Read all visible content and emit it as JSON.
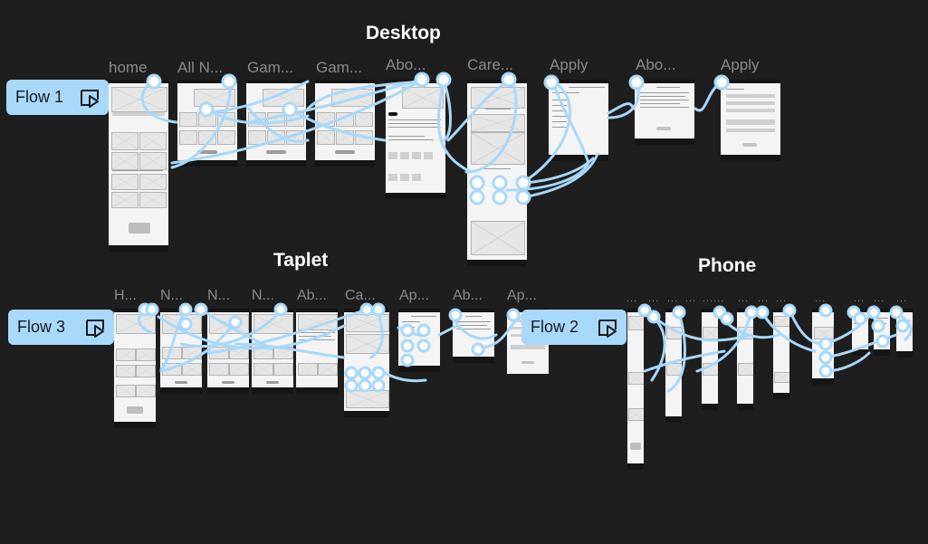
{
  "sections": {
    "desktop": "Desktop",
    "tablet": "Taplet",
    "phone": "Phone"
  },
  "flows": {
    "flow1": "Flow 1",
    "flow2": "Flow 2",
    "flow3": "Flow 3"
  },
  "desktop_frames": [
    "home",
    "All N...",
    "Gam...",
    "Gam...",
    "Abo...",
    "Care...",
    "Apply",
    "Abo...",
    "Apply"
  ],
  "tablet_frames": [
    "H...",
    "N...",
    "N...",
    "N...",
    "Ab...",
    "Ca...",
    "Ap...",
    "Ab...",
    "Ap..."
  ],
  "phone_frames": [
    "...",
    "...",
    "...",
    "...",
    "......",
    "...",
    "...",
    "...",
    "...",
    "...",
    "...",
    "..."
  ],
  "colors": {
    "background": "#1e1e1e",
    "accent": "#a8d8fa",
    "connector": "#a8d8fa",
    "frame": "#f4f4f4"
  },
  "icons": {
    "play": "play-prototype-icon"
  }
}
